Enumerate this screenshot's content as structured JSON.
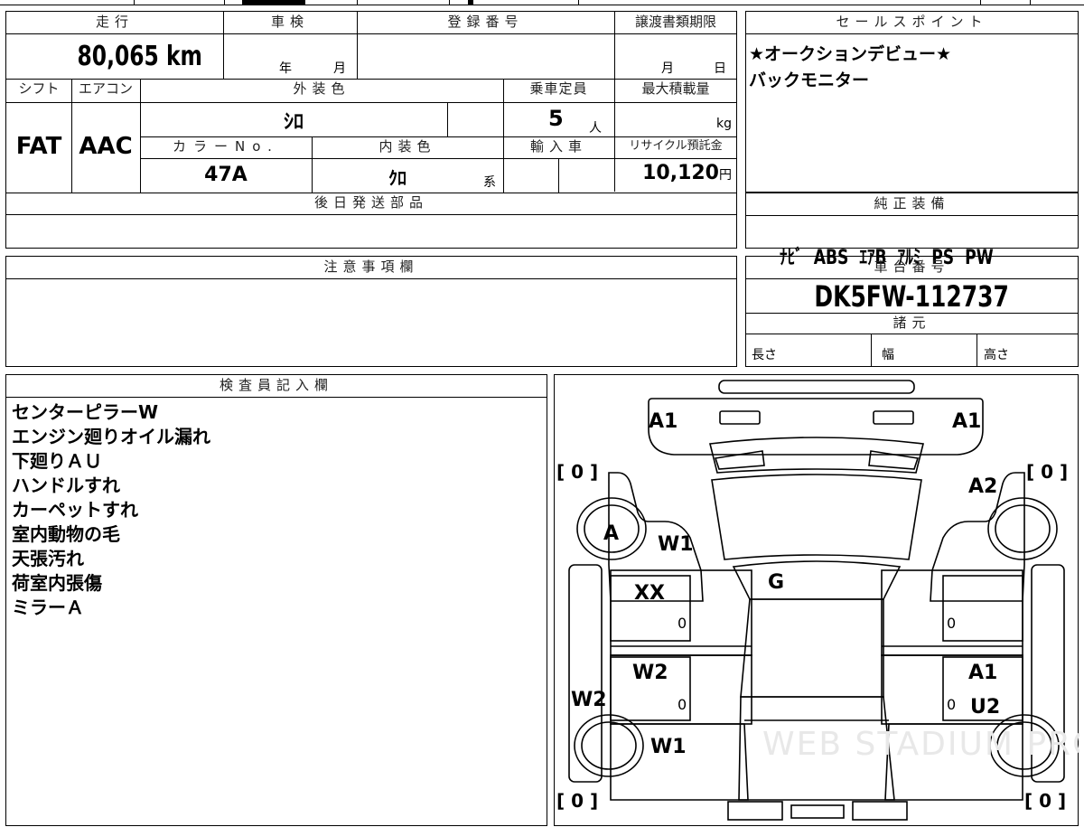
{
  "main": {
    "mileage_header": "走行",
    "mileage": "80,065",
    "mileage_unit": "km",
    "shaken_header": "車検",
    "shaken_year": "年",
    "shaken_month": "月",
    "reg_header": "登録番号",
    "transfer_header": "譲渡書類期限",
    "transfer_month": "月",
    "transfer_day": "日",
    "shift_header": "シフト",
    "shift": "FAT",
    "ac_header": "エアコン",
    "ac": "AAC",
    "exterior_header": "外装色",
    "exterior": "ｼﾛ",
    "capacity_header": "乗車定員",
    "capacity": "5",
    "capacity_unit": "人",
    "maxload_header": "最大積載量",
    "maxload_unit": "kg",
    "colorno_header": "カラーNo.",
    "colorno": "47A",
    "interior_header": "内装色",
    "interior": "ｸﾛ",
    "interior_suffix": "系",
    "import_header": "輸入車",
    "recycle_header": "リサイクル預託金",
    "recycle": "10,120",
    "recycle_unit": "円",
    "parts_header": "後日発送部品"
  },
  "sales": {
    "header": "セールスポイント",
    "lines": [
      "★オークションデビュー★",
      "バックモニター"
    ]
  },
  "equipment": {
    "header": "純正装備",
    "items": "ﾅﾋﾞ  ABS  ｴｱB  ｱﾙﾐ  PS  PW"
  },
  "caution": {
    "header": "注意事項欄"
  },
  "chassis": {
    "header": "車台番号",
    "number": "DK5FW-112737",
    "specs_header": "諸元",
    "length": "長さ",
    "width": "幅",
    "height": "高さ"
  },
  "inspector": {
    "header": "検査員記入欄",
    "notes": [
      "センターピラーW",
      "エンジン廻りオイル漏れ",
      "下廻りＡＵ",
      "ハンドルすれ",
      "カーペットすれ",
      "室内動物の毛",
      "天張汚れ",
      "荷室内張傷",
      "ミラーＡ"
    ]
  },
  "diagram": {
    "tire_fl": "[ 0 ]",
    "tire_fr": "[ 0 ]",
    "tire_rl": "[ 0 ]",
    "tire_rr": "[ 0 ]",
    "mark_a1_left": "A1",
    "mark_a1_right": "A1",
    "mark_a2": "A2",
    "mark_a": "A",
    "mark_w1_front": "W1",
    "mark_g": "G",
    "mark_xx": "XX",
    "mark_w2_door": "W2",
    "mark_w2_side": "W2",
    "mark_w1_rear": "W1",
    "mark_a1_rdoor": "A1",
    "mark_u2": "U2",
    "zero_1": "0",
    "zero_2": "0",
    "zero_3": "0",
    "zero_4": "0",
    "watermark": "WEB STADIUM PRO"
  }
}
